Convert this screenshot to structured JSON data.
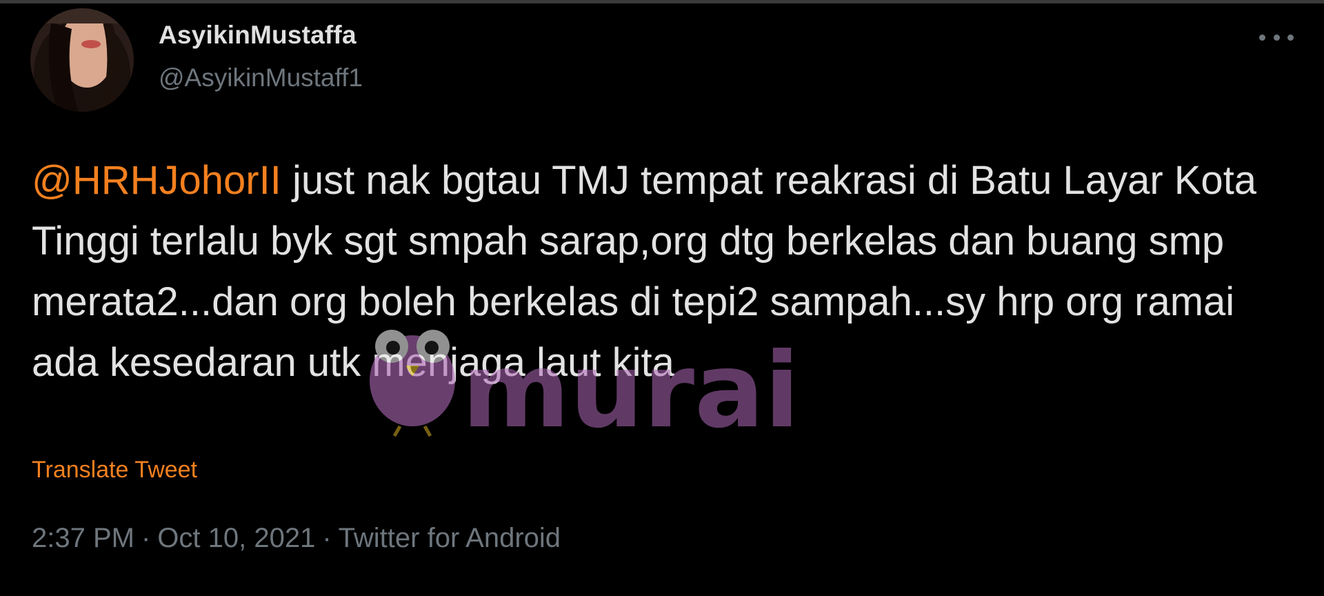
{
  "author": {
    "display_name": "AsyikinMustaffa",
    "handle": "@AsyikinMustaff1"
  },
  "tweet": {
    "mention": "@HRHJohorII",
    "text": " just nak bgtau TMJ tempat reakrasi di Batu Layar Kota Tinggi terlalu byk sgt smpah sarap,org dtg berkelas dan buang smp merata2...dan org boleh berkelas di tepi2 sampah...sy hrp org ramai ada kesedaran utk menjaga laut kita"
  },
  "translate_label": "Translate Tweet",
  "meta": {
    "time": "2:37 PM",
    "date": "Oct 10, 2021",
    "source": "Twitter for Android",
    "separator": "·"
  },
  "watermark": {
    "text": "murai"
  },
  "icons": {
    "more": "more-dots-icon",
    "avatar": "profile-photo",
    "watermark_logo": "bird-logo"
  },
  "colors": {
    "background": "#000000",
    "accent": "#f4801f",
    "muted": "#6e767d",
    "text": "#e2e2e2",
    "watermark": "#b06ab8"
  }
}
